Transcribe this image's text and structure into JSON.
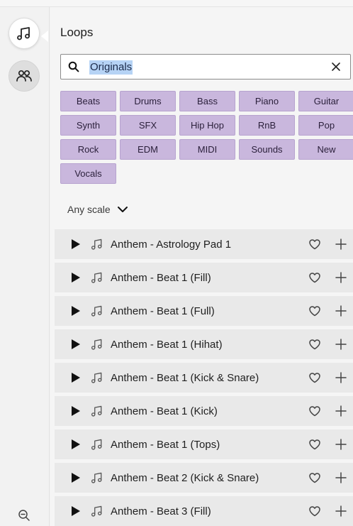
{
  "rail": {
    "items": [
      {
        "icon": "music-note-icon",
        "active": true
      },
      {
        "icon": "users-icon",
        "active": false
      }
    ],
    "bottom_icon": "zoom-out-icon"
  },
  "panel": {
    "title": "Loops",
    "search": {
      "value": "Originals",
      "clear_icon": "close-icon"
    },
    "tags": [
      "Beats",
      "Drums",
      "Bass",
      "Piano",
      "Guitar",
      "Synth",
      "SFX",
      "Hip Hop",
      "RnB",
      "Pop",
      "Rock",
      "EDM",
      "MIDI",
      "Sounds",
      "New",
      "Vocals"
    ],
    "scale_filter": {
      "label": "Any scale",
      "icon": "chevron-down-icon"
    },
    "loops": [
      "Anthem - Astrology Pad 1",
      "Anthem - Beat 1 (Fill)",
      "Anthem - Beat 1 (Full)",
      "Anthem - Beat 1 (Hihat)",
      "Anthem - Beat 1 (Kick & Snare)",
      "Anthem - Beat 1 (Kick)",
      "Anthem - Beat 1 (Tops)",
      "Anthem - Beat 2 (Kick & Snare)",
      "Anthem - Beat 3 (Fill)"
    ]
  },
  "colors": {
    "tag_fill": "#c9b7dd",
    "row_fill": "#e9e9e9",
    "selection": "#b6d3f5"
  }
}
